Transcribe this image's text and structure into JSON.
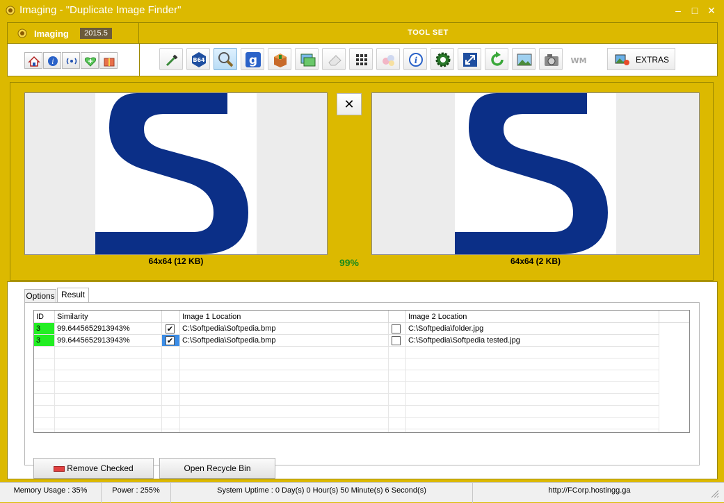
{
  "window": {
    "title": "Imaging - \"Duplicate Image Finder\"",
    "minimize_glyph": "–",
    "maximize_glyph": "□",
    "close_glyph": "✕"
  },
  "brand": {
    "name": "Imaging",
    "version": "2015.5"
  },
  "toolset": {
    "label": "TOOL SET",
    "extras_label": "EXTRAS",
    "b64_label": "B64",
    "wm_label": "WM",
    "google_label": "g"
  },
  "small_buttons": [
    "home-icon",
    "info-icon",
    "broadcast-icon",
    "heart-plus-icon",
    "gift-icon"
  ],
  "tools": [
    "eyedropper-icon",
    "base64-icon",
    "magnifier-icon",
    "google-icon",
    "box-icon",
    "image-convert-icon",
    "eraser-icon",
    "grid-icon",
    "color-drops-icon",
    "info-circle-icon",
    "gear-icon",
    "resize-icon",
    "refresh-icon",
    "picture-icon",
    "camera-icon",
    "watermark-icon"
  ],
  "active_tool": "magnifier-icon",
  "compare": {
    "left_caption": "64x64   (12 KB)",
    "right_caption": "64x64   (2 KB)",
    "similarity": "99%",
    "close_glyph": "✕"
  },
  "tabs": [
    {
      "label": "Options",
      "active": false
    },
    {
      "label": "Result",
      "active": true
    }
  ],
  "grid": {
    "columns": [
      "ID",
      "Similarity",
      "",
      "Image 1 Location",
      "",
      "Image 2 Location"
    ],
    "rows": [
      {
        "id": "3",
        "similarity": "99.6445652913943%",
        "img1_checked": true,
        "img1": "C:\\Softpedia\\Softpedia.bmp",
        "img2_checked": false,
        "img2": "C:\\Softpedia\\folder.jpg"
      },
      {
        "id": "3",
        "similarity": "99.6445652913943%",
        "img1_checked": true,
        "img1": "C:\\Softpedia\\Softpedia.bmp",
        "img2_checked": false,
        "img2": "C:\\Softpedia\\Softpedia tested.jpg"
      }
    ],
    "check_glyph": "✔"
  },
  "buttons": {
    "remove_checked": "Remove Checked",
    "open_recycle_bin": "Open Recycle Bin"
  },
  "status": {
    "memory": "Memory Usage : 35%",
    "power": "Power : 255%",
    "uptime": "System Uptime : 0 Day(s) 0 Hour(s) 50 Minute(s) 6 Second(s)",
    "url": "http://FCorp.hostingg.ga"
  },
  "colors": {
    "accent": "#dcb900",
    "id_cell": "#22ee22",
    "s_logo": "#0b2f87",
    "similarity_text": "#1a8a1a"
  }
}
